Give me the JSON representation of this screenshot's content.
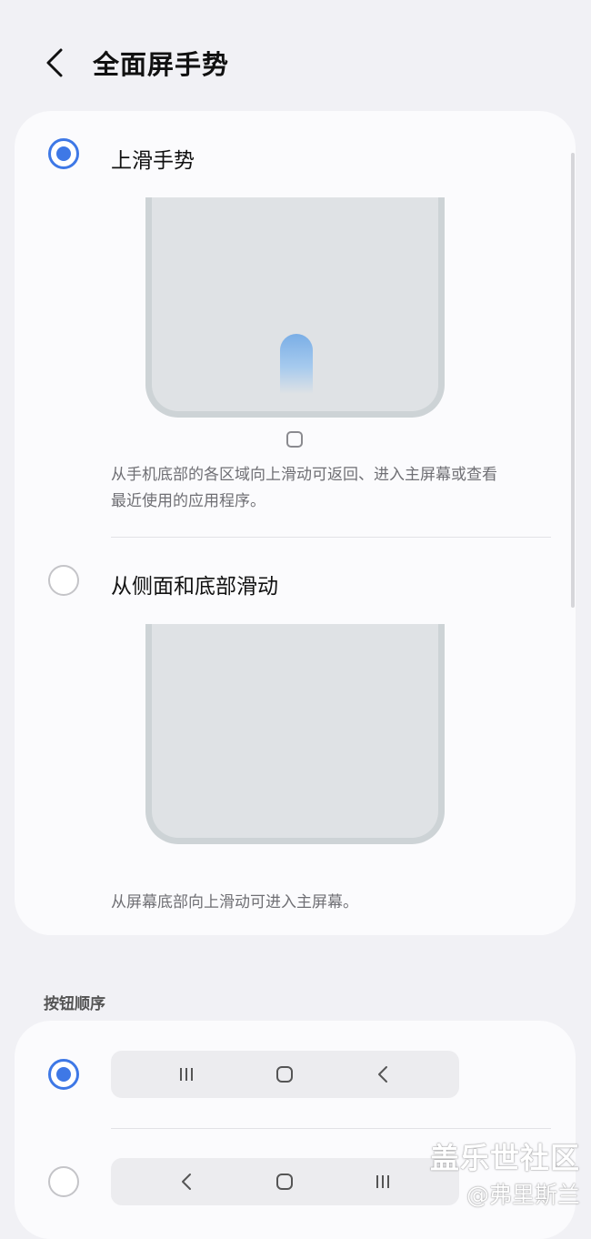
{
  "header": {
    "title": "全面屏手势"
  },
  "gesture_options": [
    {
      "label": "上滑手势",
      "selected": true,
      "description_line1": "从手机底部的各区域向上滑动可返回、进入主屏幕或查看",
      "description_line2": "最近使用的应用程序。"
    },
    {
      "label": "从侧面和底部滑动",
      "selected": false,
      "description": "从屏幕底部向上滑动可进入主屏幕。"
    }
  ],
  "button_order": {
    "section_label": "按钮顺序",
    "options": [
      {
        "selected": true,
        "icons": [
          "recents-icon",
          "home-icon",
          "back-icon"
        ]
      },
      {
        "selected": false,
        "icons": [
          "back-icon",
          "home-icon",
          "recents-icon"
        ]
      }
    ]
  },
  "watermark": {
    "line1": "盖乐世社区",
    "line2": "@弗里斯兰"
  },
  "colors": {
    "accent": "#3e78e6",
    "background": "#f1f1f5",
    "card": "#fbfbfd"
  }
}
